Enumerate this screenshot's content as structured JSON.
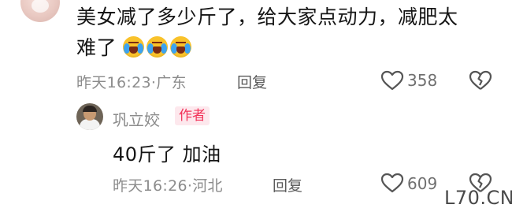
{
  "comment": {
    "text_line1": "美女减了多少斤了，给大家点动力，减肥太",
    "text_line2": "难了",
    "emoji_name": "loudly-crying-face-icon",
    "emoji_count": 3,
    "time": "昨天16:23",
    "location": "广东",
    "reply_label": "回复",
    "likes": "358"
  },
  "author_reply": {
    "name": "巩立姣",
    "badge": "作者",
    "text": "40斤了 加油",
    "time": "昨天16:26",
    "location": "河北",
    "reply_label": "回复",
    "likes": "609"
  },
  "watermark": "L70.CN",
  "colors": {
    "text": "#151515",
    "meta": "#8c8c8c",
    "badge_text": "#f2345a",
    "badge_bg": "#fde8ed"
  },
  "icons": [
    "heart-outline-icon",
    "broken-heart-icon"
  ]
}
